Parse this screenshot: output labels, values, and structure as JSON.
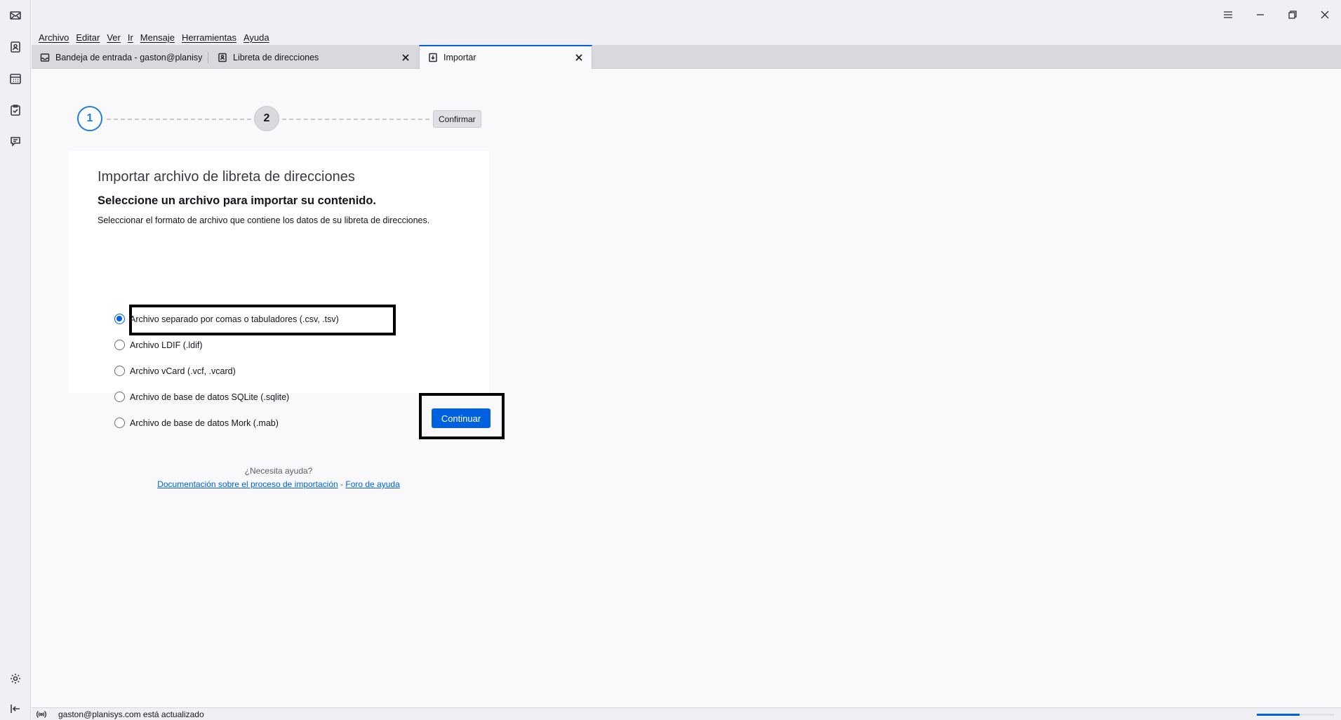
{
  "menu": [
    "Archivo",
    "Editar",
    "Ver",
    "Ir",
    "Mensaje",
    "Herramientas",
    "Ayuda"
  ],
  "tabs": [
    {
      "label": "Bandeja de entrada - gaston@planisys.",
      "icon": "inbox-icon"
    },
    {
      "label": "Libreta de direcciones",
      "icon": "address-book-icon"
    },
    {
      "label": "Importar",
      "icon": "import-icon"
    }
  ],
  "stepper": {
    "step1": "1",
    "step2": "2",
    "confirm": "Confirmar"
  },
  "card": {
    "title": "Importar archivo de libreta de direcciones",
    "heading": "Seleccione un archivo para importar su contenido.",
    "description": "Seleccionar el formato de archivo que contiene los datos de su libreta de direcciones.",
    "options": [
      {
        "label": "Archivo separado por comas o tabuladores (.csv, .tsv)",
        "checked": true
      },
      {
        "label": "Archivo LDIF (.ldif)",
        "checked": false
      },
      {
        "label": "Archivo vCard (.vcf, .vcard)",
        "checked": false
      },
      {
        "label": "Archivo de base de datos SQLite (.sqlite)",
        "checked": false
      },
      {
        "label": "Archivo de base de datos Mork (.mab)",
        "checked": false
      }
    ]
  },
  "continue_label": "Continuar",
  "help": {
    "question": "¿Necesita ayuda?",
    "doc_link": "Documentación sobre el proceso de importación",
    "separator": " - ",
    "forum_link": "Foro de ayuda"
  },
  "status": {
    "text": "gaston@planisys.com está actualizado",
    "progress": 0.55
  },
  "colors": {
    "accent": "#0061e0",
    "step_active": "#1c7ee3"
  }
}
